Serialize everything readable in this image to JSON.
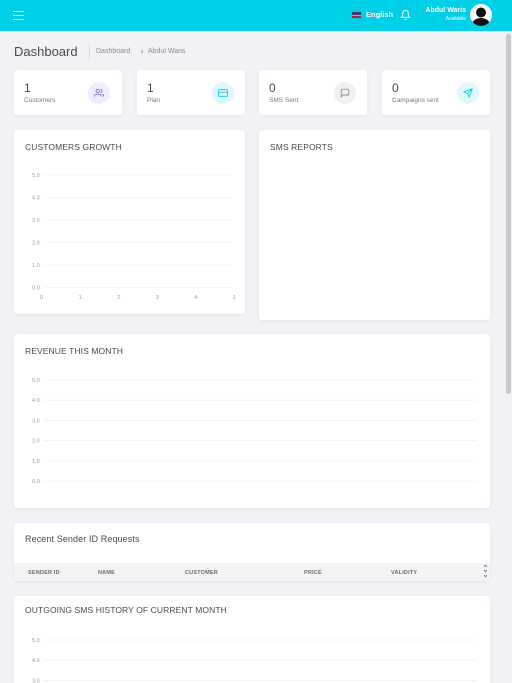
{
  "header": {
    "language": "English",
    "user_name": "Abdul Waris",
    "user_status": "Available"
  },
  "page": {
    "title": "Dashboard",
    "breadcrumb": [
      "Dashboard",
      "Abdul Waris"
    ]
  },
  "stats": [
    {
      "value": "1",
      "label": "Customers",
      "icon": "users-icon",
      "color": "#7367f0"
    },
    {
      "value": "1",
      "label": "Plan",
      "icon": "credit-card-icon",
      "color": "#00cfe8"
    },
    {
      "value": "0",
      "label": "SMS Sent",
      "icon": "message-square-icon",
      "color": "#82868b"
    },
    {
      "value": "0",
      "label": "Campaigns sent",
      "icon": "send-icon",
      "color": "#00cfe8"
    }
  ],
  "panels": {
    "customers_growth": "CUSTOMERS GROWTH",
    "sms_reports": "SMS REPORTS",
    "revenue": "REVENUE THIS MONTH",
    "sender_id": "Recent Sender ID Requests",
    "outgoing": "OUTGOING SMS HISTORY OF CURRENT MONTH"
  },
  "table": {
    "columns": [
      "SENDER ID",
      "NAME",
      "CUSTOMER",
      "PRICE",
      "VALIDITY"
    ]
  },
  "chart_data": [
    {
      "type": "line",
      "title": "CUSTOMERS GROWTH",
      "y_ticks": [
        "5.0",
        "4.0",
        "3.0",
        "2.0",
        "1.0",
        "0.0"
      ],
      "x_ticks": [
        "0",
        "1",
        "2",
        "3",
        "4",
        "1"
      ],
      "ylim": [
        0,
        5
      ],
      "series": [],
      "grid": true
    },
    {
      "type": "line",
      "title": "REVENUE THIS MONTH",
      "y_ticks": [
        "5.0",
        "4.0",
        "3.0",
        "2.0",
        "1.0",
        "0.0"
      ],
      "x_ticks": [],
      "ylim": [
        0,
        5
      ],
      "series": [],
      "grid": true
    },
    {
      "type": "line",
      "title": "OUTGOING SMS HISTORY OF CURRENT MONTH",
      "y_ticks": [
        "5.0",
        "4.0",
        "3.0"
      ],
      "x_ticks": [],
      "ylim": [
        0,
        5
      ],
      "series": [],
      "grid": true
    }
  ]
}
